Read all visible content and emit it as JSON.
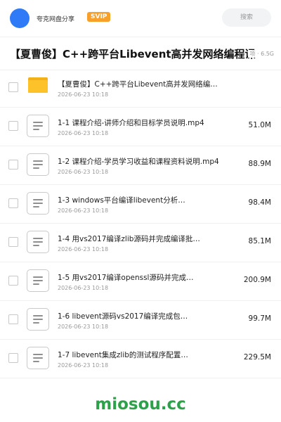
{
  "header": {
    "share_name": "夸克网盘分享",
    "badge": "SVIP",
    "search_label": "搜索"
  },
  "folder_title": {
    "title": "【夏曹俊】C++跨平台Libevent高并发网络编程课",
    "meta": "项 · 6.5G"
  },
  "items": [
    {
      "type": "folder",
      "name": "【夏曹俊】C++跨平台Libevent高并发网络编…",
      "date": "2026-06-23 10:18",
      "size": ""
    },
    {
      "type": "file",
      "name": "1-1 课程介绍-讲师介绍和目标学员说明.mp4",
      "date": "2026-06-23 10:18",
      "size": "51.0M"
    },
    {
      "type": "file",
      "name": "1-2 课程介绍-学员学习收益和课程资料说明.mp4",
      "date": "2026-06-23 10:18",
      "size": "88.9M"
    },
    {
      "type": "file",
      "name": "1-3 windows平台编译libevent分析…",
      "date": "2026-06-23 10:18",
      "size": "98.4M"
    },
    {
      "type": "file",
      "name": "1-4 用vs2017编译zlib源码并完成编译批…",
      "date": "2026-06-23 10:18",
      "size": "85.1M"
    },
    {
      "type": "file",
      "name": "1-5 用vs2017编译openssl源码并完成…",
      "date": "2026-06-23 10:18",
      "size": "200.9M"
    },
    {
      "type": "file",
      "name": "1-6 libevent源码vs2017编译完成包…",
      "date": "2026-06-23 10:18",
      "size": "99.7M"
    },
    {
      "type": "file",
      "name": "1-7 libevent集成zlib的测试程序配置…",
      "date": "2026-06-23 10:18",
      "size": "229.5M"
    }
  ],
  "watermark": "miosou.cc",
  "colors": {
    "accent": "#2f7af7",
    "svip": "#f7a12a",
    "folder": "#fdc12a",
    "watermark": "#2ca14a"
  }
}
